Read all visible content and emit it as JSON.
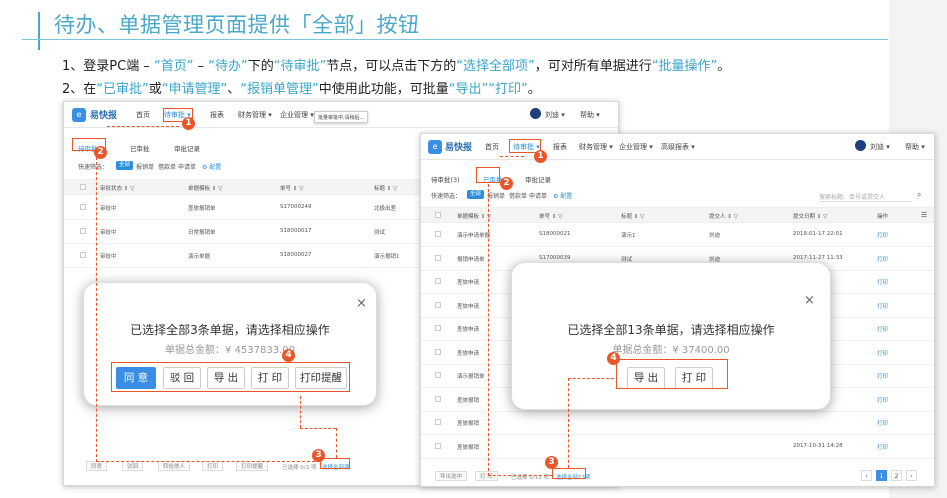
{
  "title": "待办、单据管理页面提供「全部」按钮",
  "desc": {
    "line1": [
      {
        "t": "1、登录PC端 – ",
        "h": false
      },
      {
        "t": "“首页”",
        "h": true
      },
      {
        "t": " – ",
        "h": false
      },
      {
        "t": "“待办”",
        "h": true
      },
      {
        "t": "下的",
        "h": false
      },
      {
        "t": "“待审批”",
        "h": true
      },
      {
        "t": "节点，可以点击下方的",
        "h": false
      },
      {
        "t": "“选择全部项”",
        "h": true
      },
      {
        "t": "，可对所有单据进行",
        "h": false
      },
      {
        "t": "“批量操作”",
        "h": true
      },
      {
        "t": "。",
        "h": false
      }
    ],
    "line2": [
      {
        "t": "2、在",
        "h": false
      },
      {
        "t": "“已审批”",
        "h": true
      },
      {
        "t": "或",
        "h": false
      },
      {
        "t": "“申请管理”",
        "h": true
      },
      {
        "t": "、",
        "h": false
      },
      {
        "t": "“报销单管理”",
        "h": true
      },
      {
        "t": "中使用此功能，可批量",
        "h": false
      },
      {
        "t": "“导出”",
        "h": true
      },
      {
        "t": "“打印”",
        "h": true
      },
      {
        "t": "。",
        "h": false
      }
    ]
  },
  "badges": {
    "b1": "1",
    "b2": "2",
    "b3": "3",
    "b4": "4"
  },
  "win_left": {
    "brand": "易快报",
    "nav": [
      "首页",
      "待审批 ▾",
      "报表",
      "财务管理 ▾",
      "企业管理 ▾"
    ],
    "tooltip": "批量审批中,请稍后...",
    "user": "刘迪 ▾",
    "help": "帮助 ▾",
    "tabs": [
      "待审批(3)",
      "已审批",
      "审批记录"
    ],
    "quick_filter": "快速筛选：",
    "chips": [
      "全部",
      "报销单",
      "借款单",
      "申请单"
    ],
    "config": "⚙ 配置",
    "columns": [
      "审批状态 ⇕ ▽",
      "单据模板 ⇕ ▽",
      "单号 ⇕ ▽",
      "标题 ⇕ ▽"
    ],
    "rows": [
      [
        "审批中",
        "差旅报销单",
        "S17000249",
        "北极出差"
      ],
      [
        "审批中",
        "日常报销单",
        "S18000017",
        "测试"
      ],
      [
        "审批中",
        "演示单据",
        "S18000027",
        "演示报销1"
      ]
    ],
    "footer_buttons": [
      "同意",
      "驳回",
      "转给他人",
      "打印",
      "打印提醒"
    ],
    "footer_text": "已选择 0/3 项",
    "select_all": "选择全部项",
    "dialog": {
      "title": "已选择全部3条单据，请选择相应操作",
      "amount": "单据总金额：¥ 4537833.00",
      "close": "×",
      "buttons": [
        "同 意",
        "驳 回",
        "导 出",
        "打 印",
        "打印提醒"
      ]
    }
  },
  "win_right": {
    "brand": "易快报",
    "nav": [
      "首页",
      "待审批 ▾",
      "报表",
      "财务管理 ▾",
      "企业管理 ▾",
      "高级报表 ▾"
    ],
    "user": "刘迪 ▾",
    "help": "帮助 ▾",
    "tabs": [
      "待审批(3)",
      "已审批",
      "审批记录"
    ],
    "quick_filter": "快速筛选：",
    "chips": [
      "全部",
      "报销单",
      "借款单",
      "申请单"
    ],
    "config": "⚙ 配置",
    "search_placeholder": "搜索标题、单号或提交人",
    "columns": [
      "单据模板 ⇕ ▽",
      "单号 ⇕ ▽",
      "标题 ⇕ ▽",
      "提交人 ⇕ ▽",
      "提交日期 ⇕ ▽",
      "操作"
    ],
    "rows": [
      [
        "演示申请单据",
        "S18000021",
        "演示1",
        "刘迪",
        "2018-01-17 22:01",
        "打印"
      ],
      [
        "报销申请单",
        "S17000039",
        "测试",
        "刘迪",
        "2017-11-27 11:33",
        "打印"
      ],
      [
        "差旅申请",
        "",
        "",
        "",
        "",
        "打印"
      ],
      [
        "差旅申请",
        "",
        "",
        "",
        "",
        "打印"
      ],
      [
        "差旅申请",
        "",
        "",
        "",
        "",
        "打印"
      ],
      [
        "差旅申请",
        "",
        "",
        "",
        "",
        "打印"
      ],
      [
        "演示报销单",
        "",
        "",
        "",
        "",
        "打印"
      ],
      [
        "差旅报销",
        "",
        "",
        "",
        "",
        "打印"
      ],
      [
        "差旅报销",
        "",
        "",
        "",
        "",
        "打印"
      ],
      [
        "差旅报销",
        "",
        "",
        "",
        "2017-10-31 14:28",
        "打印"
      ]
    ],
    "footer_buttons": [
      "导出选中",
      "打 印"
    ],
    "footer_text": "已选择 0/13 项",
    "select_all": "选择全部13项",
    "pages": [
      "‹",
      "1",
      "2",
      "›"
    ],
    "dialog": {
      "title": "已选择全部13条单据，请选择相应操作",
      "amount": "单据总金额：¥ 37400.00",
      "close": "×",
      "buttons": [
        "导 出",
        "打 印"
      ]
    }
  },
  "colors": {
    "accent": "#3aa6cc",
    "primary": "#3a8ee6",
    "annotation": "#e8562a"
  }
}
